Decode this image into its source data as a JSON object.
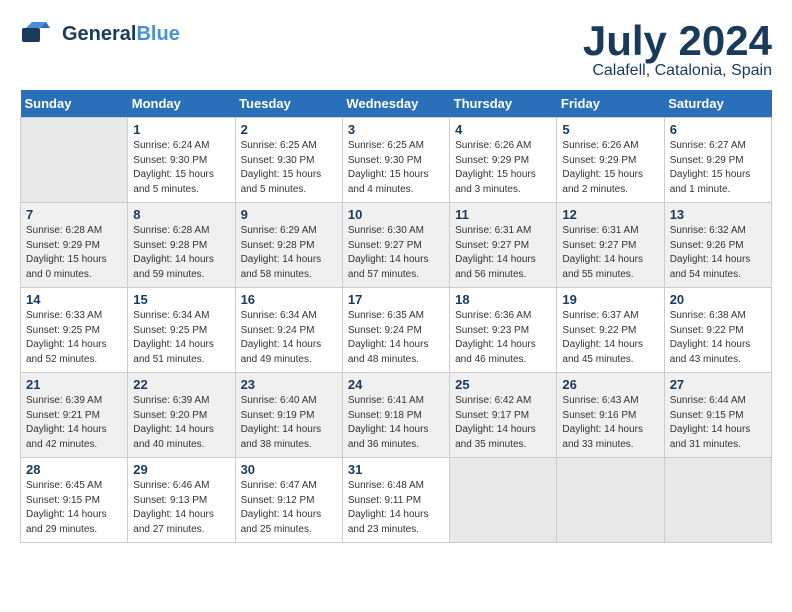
{
  "header": {
    "logo_general": "General",
    "logo_blue": "Blue",
    "month": "July 2024",
    "location": "Calafell, Catalonia, Spain"
  },
  "days_of_week": [
    "Sunday",
    "Monday",
    "Tuesday",
    "Wednesday",
    "Thursday",
    "Friday",
    "Saturday"
  ],
  "weeks": [
    [
      {
        "day": "",
        "empty": true
      },
      {
        "day": "1",
        "sunrise": "Sunrise: 6:24 AM",
        "sunset": "Sunset: 9:30 PM",
        "daylight": "Daylight: 15 hours and 5 minutes."
      },
      {
        "day": "2",
        "sunrise": "Sunrise: 6:25 AM",
        "sunset": "Sunset: 9:30 PM",
        "daylight": "Daylight: 15 hours and 5 minutes."
      },
      {
        "day": "3",
        "sunrise": "Sunrise: 6:25 AM",
        "sunset": "Sunset: 9:30 PM",
        "daylight": "Daylight: 15 hours and 4 minutes."
      },
      {
        "day": "4",
        "sunrise": "Sunrise: 6:26 AM",
        "sunset": "Sunset: 9:29 PM",
        "daylight": "Daylight: 15 hours and 3 minutes."
      },
      {
        "day": "5",
        "sunrise": "Sunrise: 6:26 AM",
        "sunset": "Sunset: 9:29 PM",
        "daylight": "Daylight: 15 hours and 2 minutes."
      },
      {
        "day": "6",
        "sunrise": "Sunrise: 6:27 AM",
        "sunset": "Sunset: 9:29 PM",
        "daylight": "Daylight: 15 hours and 1 minute."
      }
    ],
    [
      {
        "day": "7",
        "sunrise": "Sunrise: 6:28 AM",
        "sunset": "Sunset: 9:29 PM",
        "daylight": "Daylight: 15 hours and 0 minutes."
      },
      {
        "day": "8",
        "sunrise": "Sunrise: 6:28 AM",
        "sunset": "Sunset: 9:28 PM",
        "daylight": "Daylight: 14 hours and 59 minutes."
      },
      {
        "day": "9",
        "sunrise": "Sunrise: 6:29 AM",
        "sunset": "Sunset: 9:28 PM",
        "daylight": "Daylight: 14 hours and 58 minutes."
      },
      {
        "day": "10",
        "sunrise": "Sunrise: 6:30 AM",
        "sunset": "Sunset: 9:27 PM",
        "daylight": "Daylight: 14 hours and 57 minutes."
      },
      {
        "day": "11",
        "sunrise": "Sunrise: 6:31 AM",
        "sunset": "Sunset: 9:27 PM",
        "daylight": "Daylight: 14 hours and 56 minutes."
      },
      {
        "day": "12",
        "sunrise": "Sunrise: 6:31 AM",
        "sunset": "Sunset: 9:27 PM",
        "daylight": "Daylight: 14 hours and 55 minutes."
      },
      {
        "day": "13",
        "sunrise": "Sunrise: 6:32 AM",
        "sunset": "Sunset: 9:26 PM",
        "daylight": "Daylight: 14 hours and 54 minutes."
      }
    ],
    [
      {
        "day": "14",
        "sunrise": "Sunrise: 6:33 AM",
        "sunset": "Sunset: 9:25 PM",
        "daylight": "Daylight: 14 hours and 52 minutes."
      },
      {
        "day": "15",
        "sunrise": "Sunrise: 6:34 AM",
        "sunset": "Sunset: 9:25 PM",
        "daylight": "Daylight: 14 hours and 51 minutes."
      },
      {
        "day": "16",
        "sunrise": "Sunrise: 6:34 AM",
        "sunset": "Sunset: 9:24 PM",
        "daylight": "Daylight: 14 hours and 49 minutes."
      },
      {
        "day": "17",
        "sunrise": "Sunrise: 6:35 AM",
        "sunset": "Sunset: 9:24 PM",
        "daylight": "Daylight: 14 hours and 48 minutes."
      },
      {
        "day": "18",
        "sunrise": "Sunrise: 6:36 AM",
        "sunset": "Sunset: 9:23 PM",
        "daylight": "Daylight: 14 hours and 46 minutes."
      },
      {
        "day": "19",
        "sunrise": "Sunrise: 6:37 AM",
        "sunset": "Sunset: 9:22 PM",
        "daylight": "Daylight: 14 hours and 45 minutes."
      },
      {
        "day": "20",
        "sunrise": "Sunrise: 6:38 AM",
        "sunset": "Sunset: 9:22 PM",
        "daylight": "Daylight: 14 hours and 43 minutes."
      }
    ],
    [
      {
        "day": "21",
        "sunrise": "Sunrise: 6:39 AM",
        "sunset": "Sunset: 9:21 PM",
        "daylight": "Daylight: 14 hours and 42 minutes."
      },
      {
        "day": "22",
        "sunrise": "Sunrise: 6:39 AM",
        "sunset": "Sunset: 9:20 PM",
        "daylight": "Daylight: 14 hours and 40 minutes."
      },
      {
        "day": "23",
        "sunrise": "Sunrise: 6:40 AM",
        "sunset": "Sunset: 9:19 PM",
        "daylight": "Daylight: 14 hours and 38 minutes."
      },
      {
        "day": "24",
        "sunrise": "Sunrise: 6:41 AM",
        "sunset": "Sunset: 9:18 PM",
        "daylight": "Daylight: 14 hours and 36 minutes."
      },
      {
        "day": "25",
        "sunrise": "Sunrise: 6:42 AM",
        "sunset": "Sunset: 9:17 PM",
        "daylight": "Daylight: 14 hours and 35 minutes."
      },
      {
        "day": "26",
        "sunrise": "Sunrise: 6:43 AM",
        "sunset": "Sunset: 9:16 PM",
        "daylight": "Daylight: 14 hours and 33 minutes."
      },
      {
        "day": "27",
        "sunrise": "Sunrise: 6:44 AM",
        "sunset": "Sunset: 9:15 PM",
        "daylight": "Daylight: 14 hours and 31 minutes."
      }
    ],
    [
      {
        "day": "28",
        "sunrise": "Sunrise: 6:45 AM",
        "sunset": "Sunset: 9:15 PM",
        "daylight": "Daylight: 14 hours and 29 minutes."
      },
      {
        "day": "29",
        "sunrise": "Sunrise: 6:46 AM",
        "sunset": "Sunset: 9:13 PM",
        "daylight": "Daylight: 14 hours and 27 minutes."
      },
      {
        "day": "30",
        "sunrise": "Sunrise: 6:47 AM",
        "sunset": "Sunset: 9:12 PM",
        "daylight": "Daylight: 14 hours and 25 minutes."
      },
      {
        "day": "31",
        "sunrise": "Sunrise: 6:48 AM",
        "sunset": "Sunset: 9:11 PM",
        "daylight": "Daylight: 14 hours and 23 minutes."
      },
      {
        "day": "",
        "empty": true
      },
      {
        "day": "",
        "empty": true
      },
      {
        "day": "",
        "empty": true
      }
    ]
  ]
}
